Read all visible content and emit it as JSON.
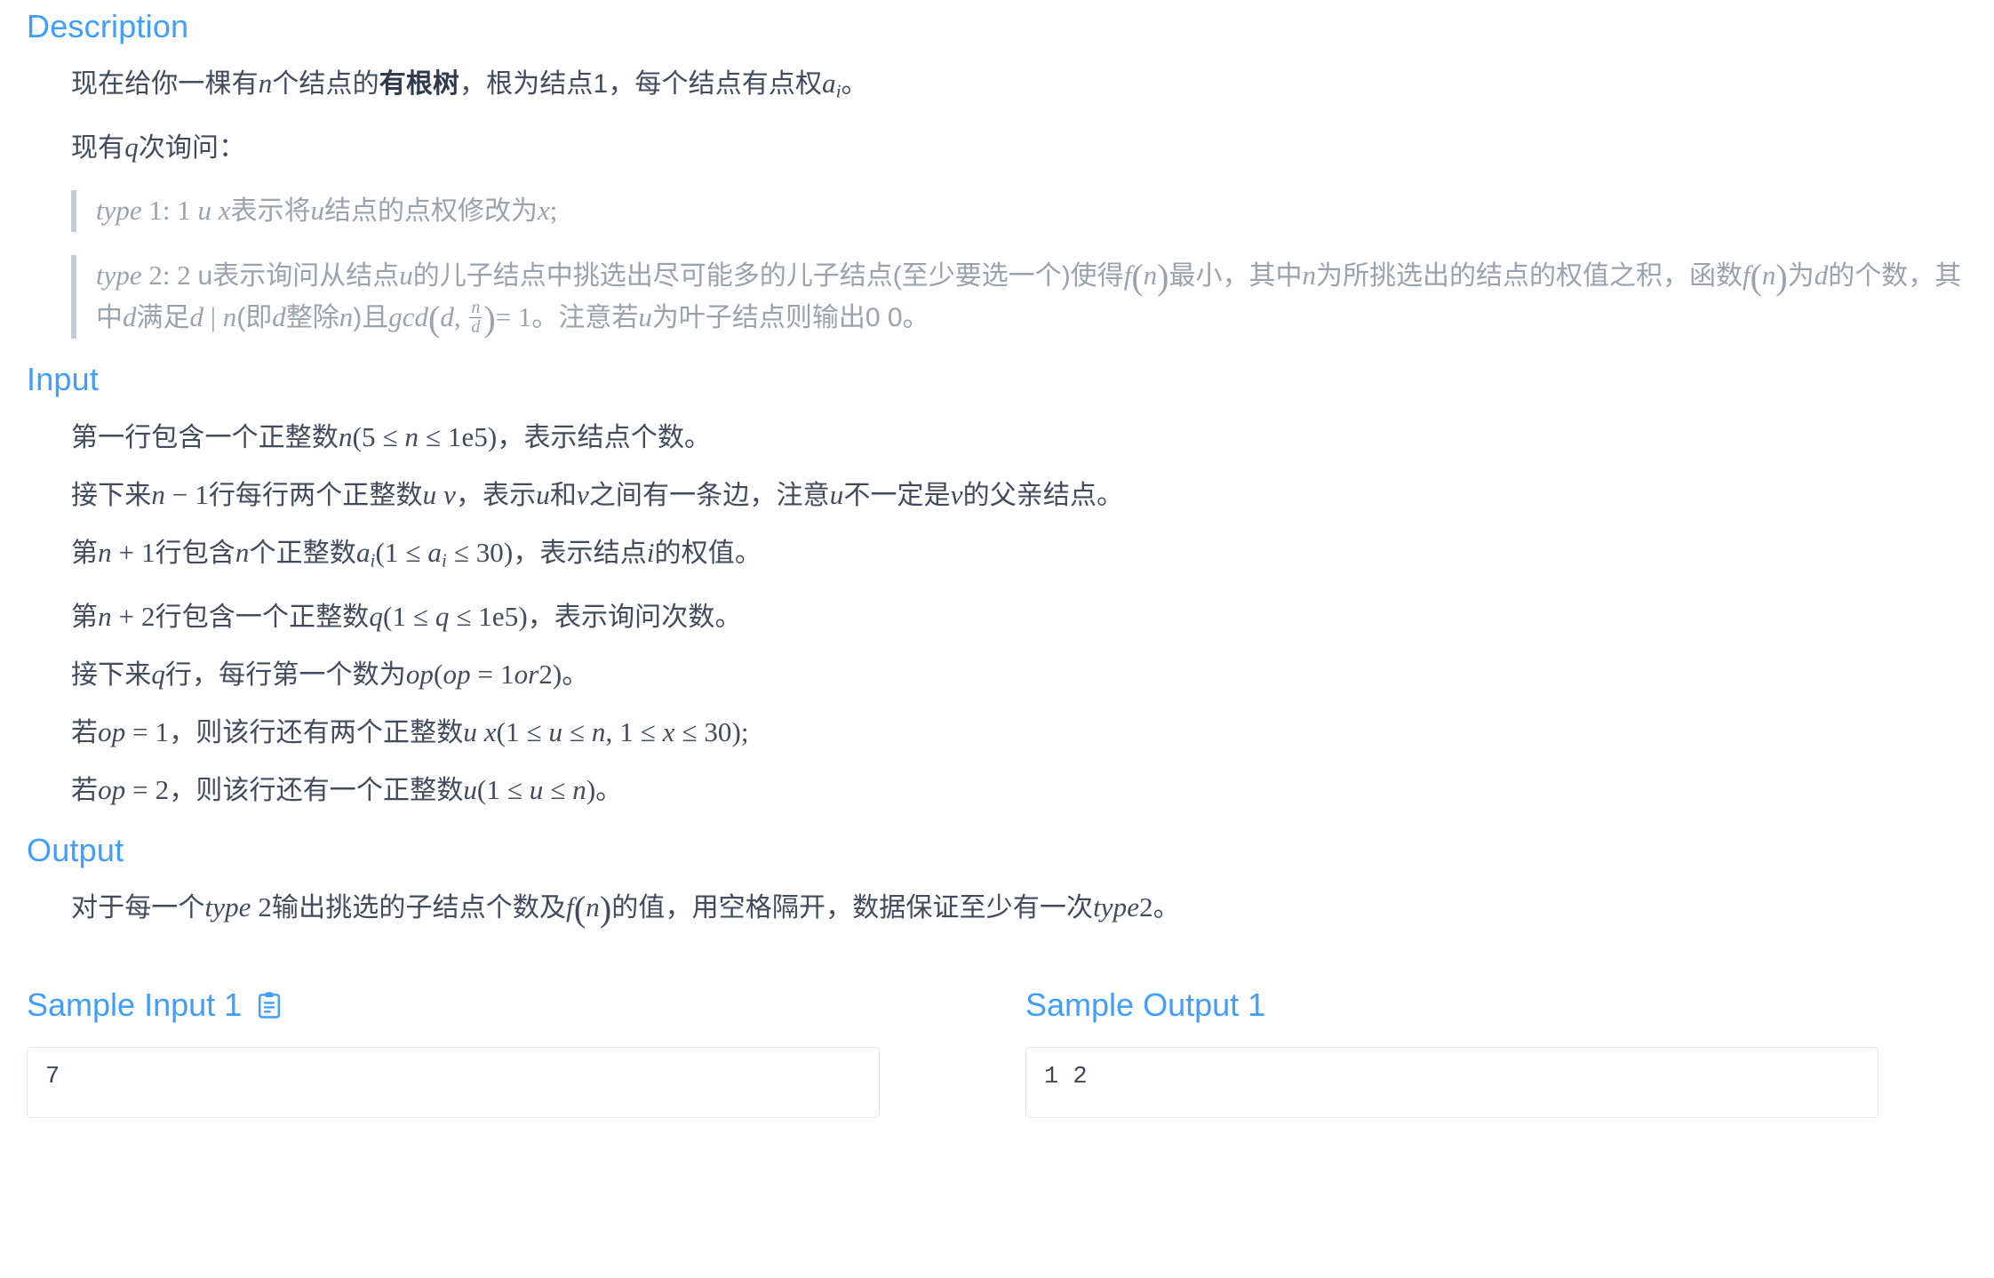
{
  "sections": {
    "description": {
      "title": "Description",
      "p1_pre": "现在给你一棵有",
      "p1_n": "n",
      "p1_mid": "个结点的",
      "p1_bold": "有根树",
      "p1_mid2": "，根为结点1，每个结点有点权",
      "p1_a": "a",
      "p1_a_sub": "i",
      "p1_end": "。",
      "p2_pre": "现有",
      "p2_q": "q",
      "p2_end": "次询问：",
      "quote1": {
        "type_label": "type",
        "rest_pre": " 1: 1 ",
        "u": "u",
        "x": "x",
        "cn": "表示将",
        "u2": "u",
        "cn2": "结点的点权修改为",
        "x2": "x",
        "end": ";"
      },
      "quote2": {
        "type_label": "type",
        "num": " 2: 2 ",
        "t1": "u表示询问从结点",
        "u": "u",
        "t2": "的儿子结点中挑选出尽可能多的儿子结点(至少要选一个)使得",
        "f": "f",
        "n1": "n",
        "t3": "最小，其中",
        "n2": "n",
        "t4": "为所挑选出的结点的权值之积，函数",
        "f2": "f",
        "n3": "n",
        "t5": "为",
        "d1": "d",
        "t6": "的个数，其中",
        "d2": "d",
        "t7": "满足",
        "d3": "d",
        "mid_bar": "|",
        "n4": "n",
        "t8": "(即",
        "d4": "d",
        "t9": "整除",
        "n5": "n",
        "t10": ")且",
        "gcd": "gcd",
        "d5": "d",
        "frac_num": "n",
        "frac_den": "d",
        "eq1": "= 1",
        "t11": "。注意若",
        "u3": "u",
        "t12": "为叶子结点则输出0 0。"
      }
    },
    "input": {
      "title": "Input",
      "lines": [
        {
          "parts": [
            {
              "t": "cn",
              "v": "第一行包含一个正整数"
            },
            {
              "t": "mi",
              "v": "n"
            },
            {
              "t": "mu",
              "v": "(5 ≤ "
            },
            {
              "t": "mi",
              "v": "n"
            },
            {
              "t": "mu",
              "v": " ≤ 1e5)"
            },
            {
              "t": "cn",
              "v": "，表示结点个数。"
            }
          ]
        },
        {
          "parts": [
            {
              "t": "cn",
              "v": "接下来"
            },
            {
              "t": "mi",
              "v": "n"
            },
            {
              "t": "mu",
              "v": " − 1"
            },
            {
              "t": "cn",
              "v": "行每行两个正整数"
            },
            {
              "t": "mi",
              "v": "u v"
            },
            {
              "t": "cn",
              "v": "，表示"
            },
            {
              "t": "mi",
              "v": "u"
            },
            {
              "t": "cn",
              "v": "和"
            },
            {
              "t": "mi",
              "v": "v"
            },
            {
              "t": "cn",
              "v": "之间有一条边，注意"
            },
            {
              "t": "mi",
              "v": "u"
            },
            {
              "t": "cn",
              "v": "不一定是"
            },
            {
              "t": "mi",
              "v": "v"
            },
            {
              "t": "cn",
              "v": "的父亲结点。"
            }
          ]
        },
        {
          "parts": [
            {
              "t": "cn",
              "v": "第"
            },
            {
              "t": "mi",
              "v": "n"
            },
            {
              "t": "mu",
              "v": " + 1"
            },
            {
              "t": "cn",
              "v": "行包含"
            },
            {
              "t": "mi",
              "v": "n"
            },
            {
              "t": "cn",
              "v": "个正整数"
            },
            {
              "t": "misub",
              "v": "a",
              "sub": "i"
            },
            {
              "t": "mu",
              "v": "(1 ≤ "
            },
            {
              "t": "misub",
              "v": "a",
              "sub": "i"
            },
            {
              "t": "mu",
              "v": " ≤ 30)"
            },
            {
              "t": "cn",
              "v": "，表示结点"
            },
            {
              "t": "mi",
              "v": "i"
            },
            {
              "t": "cn",
              "v": "的权值。"
            }
          ]
        },
        {
          "parts": [
            {
              "t": "cn",
              "v": "第"
            },
            {
              "t": "mi",
              "v": "n"
            },
            {
              "t": "mu",
              "v": " + 2"
            },
            {
              "t": "cn",
              "v": "行包含一个正整数"
            },
            {
              "t": "mi",
              "v": "q"
            },
            {
              "t": "mu",
              "v": "(1 ≤ "
            },
            {
              "t": "mi",
              "v": "q"
            },
            {
              "t": "mu",
              "v": " ≤ 1e5)"
            },
            {
              "t": "cn",
              "v": "，表示询问次数。"
            }
          ]
        },
        {
          "parts": [
            {
              "t": "cn",
              "v": "接下来"
            },
            {
              "t": "mi",
              "v": "q"
            },
            {
              "t": "cn",
              "v": "行，每行第一个数为"
            },
            {
              "t": "mi",
              "v": "op"
            },
            {
              "t": "mu",
              "v": "("
            },
            {
              "t": "mi",
              "v": "op"
            },
            {
              "t": "mu",
              "v": " = 1"
            },
            {
              "t": "mi",
              "v": "or"
            },
            {
              "t": "mu",
              "v": "2)"
            },
            {
              "t": "cn",
              "v": "。"
            }
          ]
        },
        {
          "parts": [
            {
              "t": "cn",
              "v": "若"
            },
            {
              "t": "mi",
              "v": "op"
            },
            {
              "t": "mu",
              "v": " = 1"
            },
            {
              "t": "cn",
              "v": "，则该行还有两个正整数"
            },
            {
              "t": "mi",
              "v": "u x"
            },
            {
              "t": "mu",
              "v": "(1 ≤ "
            },
            {
              "t": "mi",
              "v": "u"
            },
            {
              "t": "mu",
              "v": " ≤ "
            },
            {
              "t": "mi",
              "v": "n"
            },
            {
              "t": "mu",
              "v": ", 1 ≤ "
            },
            {
              "t": "mi",
              "v": "x"
            },
            {
              "t": "mu",
              "v": " ≤ 30);"
            }
          ]
        },
        {
          "parts": [
            {
              "t": "cn",
              "v": "若"
            },
            {
              "t": "mi",
              "v": "op"
            },
            {
              "t": "mu",
              "v": " = 2"
            },
            {
              "t": "cn",
              "v": "，则该行还有一个正整数"
            },
            {
              "t": "mi",
              "v": "u"
            },
            {
              "t": "mu",
              "v": "(1 ≤ "
            },
            {
              "t": "mi",
              "v": "u"
            },
            {
              "t": "mu",
              "v": " ≤ "
            },
            {
              "t": "mi",
              "v": "n"
            },
            {
              "t": "mu",
              "v": ")"
            },
            {
              "t": "cn",
              "v": "。"
            }
          ]
        }
      ]
    },
    "output": {
      "title": "Output",
      "line_pre": "对于每一个",
      "type_label": "type",
      "num2": " 2",
      "line_mid": "输出挑选的子结点个数及",
      "f": "f",
      "n": "n",
      "line_mid2": "的值，用空格隔开，数据保证至少有一次",
      "type_label2": "type",
      "num2b": "2",
      "line_end": "。"
    }
  },
  "samples": {
    "input": {
      "title": "Sample Input 1",
      "copy_icon": "clipboard-icon",
      "content": "7"
    },
    "output": {
      "title": "Sample Output 1",
      "content": "1 2"
    }
  },
  "colors": {
    "accent": "#409eff",
    "text": "#3c4858",
    "muted": "#9aa3ad",
    "border": "#e3e6ea"
  }
}
